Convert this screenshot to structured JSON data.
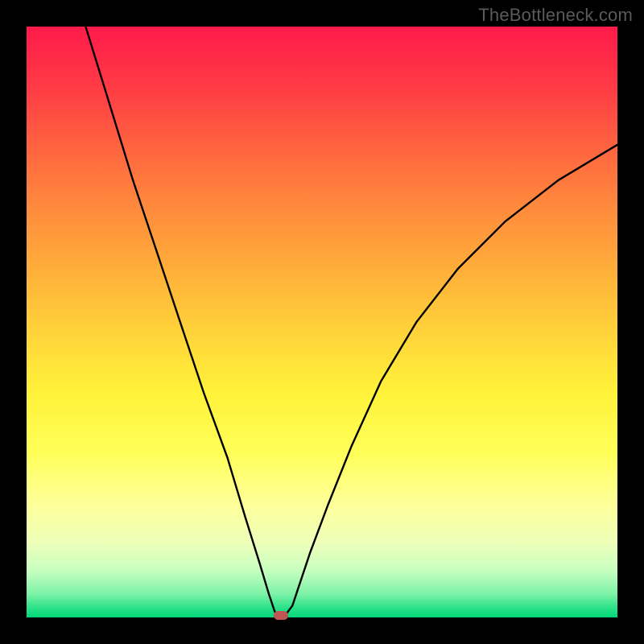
{
  "watermark": "TheBottleneck.com",
  "chart_data": {
    "type": "line",
    "title": "",
    "xlabel": "",
    "ylabel": "",
    "xlim": [
      0,
      100
    ],
    "ylim": [
      0,
      100
    ],
    "grid": false,
    "series": [
      {
        "name": "curve",
        "x": [
          10,
          14,
          18,
          22,
          26,
          30,
          34,
          37,
          39.5,
          41,
          42,
          42.8,
          43.5,
          45,
          46,
          48,
          51,
          55,
          60,
          66,
          73,
          81,
          90,
          100
        ],
        "y": [
          100,
          87,
          74,
          62,
          50,
          38,
          27,
          17,
          9,
          4,
          1,
          0,
          0,
          2,
          5,
          11,
          19,
          29,
          40,
          50,
          59,
          67,
          74,
          80
        ]
      }
    ],
    "marker": {
      "x": 43,
      "y": 0
    },
    "gradient_stops": [
      {
        "pos": 0,
        "color": "#ff1a4a"
      },
      {
        "pos": 50,
        "color": "#ffe53a"
      },
      {
        "pos": 85,
        "color": "#ffff94"
      },
      {
        "pos": 100,
        "color": "#00d878"
      }
    ]
  }
}
